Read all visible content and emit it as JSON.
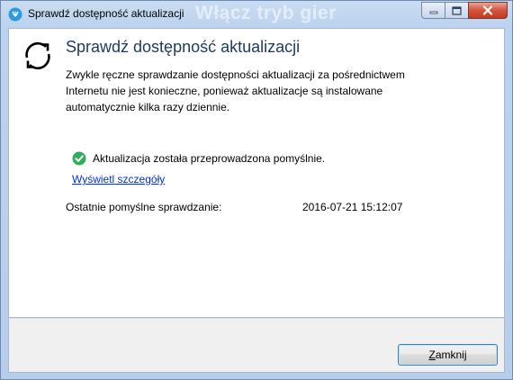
{
  "window": {
    "title": "Sprawdź dostępność aktualizacji",
    "background_ghost_text": "Włącz tryb gier"
  },
  "content": {
    "heading": "Sprawdź dostępność aktualizacji",
    "description": "Zwykle ręczne sprawdzanie dostępności aktualizacji za pośrednictwem\nInternetu nie jest konieczne, ponieważ aktualizacje są instalowane\nautomatycznie kilka razy dziennie.",
    "status_text": "Aktualizacja została przeprowadzona pomyślnie.",
    "details_link": "Wyświetl szczegóły",
    "last_check_label": "Ostatnie pomyślne sprawdzanie:",
    "last_check_value": "2016-07-21 15:12:07"
  },
  "footer": {
    "close_button_first": "Z",
    "close_button_rest": "amknij"
  },
  "colors": {
    "accent": "#1c3a5e",
    "link": "#0033cc",
    "success": "#2fae5b",
    "app_icon": "#2a9be0"
  },
  "icons": {
    "app": "shield-logo-icon",
    "refresh": "refresh-icon",
    "status": "check-circle-icon"
  }
}
